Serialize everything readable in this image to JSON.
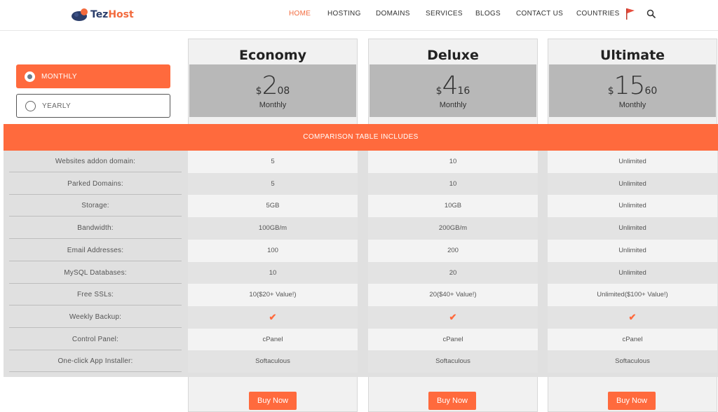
{
  "nav": {
    "logo_a": "Tez",
    "logo_b": "Host",
    "items": [
      "HOME",
      "HOSTING",
      "DOMAINS",
      "SERVICES",
      "BLOGS",
      "CONTACT US",
      "COUNTRIES"
    ]
  },
  "billing": {
    "monthly": "MONTHLY",
    "yearly": "YEARLY"
  },
  "plans": [
    {
      "name": "Economy",
      "currency": "$",
      "whole": "2",
      "cents": "08",
      "period": "Monthly",
      "buy": "Buy Now"
    },
    {
      "name": "Deluxe",
      "currency": "$",
      "whole": "4",
      "cents": "16",
      "period": "Monthly",
      "buy": "Buy Now"
    },
    {
      "name": "Ultimate",
      "currency": "$",
      "whole": "15",
      "cents": "60",
      "period": "Monthly",
      "buy": "Buy Now"
    }
  ],
  "comparison_title": "COMPARISON TABLE INCLUDES",
  "rows": [
    {
      "label": "Websites addon domain:",
      "values": [
        "5",
        "10",
        "Unlimited"
      ]
    },
    {
      "label": "Parked Domains:",
      "values": [
        "5",
        "10",
        "Unlimited"
      ]
    },
    {
      "label": "Storage:",
      "values": [
        "5GB",
        "10GB",
        "Unlimited"
      ]
    },
    {
      "label": "Bandwidth:",
      "values": [
        "100GB/m",
        "200GB/m",
        "Unlimited"
      ]
    },
    {
      "label": "Email Addresses:",
      "values": [
        "100",
        "200",
        "Unlimited"
      ]
    },
    {
      "label": "MySQL Databases:",
      "values": [
        "10",
        "20",
        "Unlimited"
      ]
    },
    {
      "label": "Free SSLs:",
      "values": [
        "10($20+ Value!)",
        "20($40+ Value!)",
        "Unlimited($100+ Value!)"
      ]
    },
    {
      "label": "Weekly Backup:",
      "values": [
        "✔",
        "✔",
        "✔"
      ]
    },
    {
      "label": "Control Panel:",
      "values": [
        "cPanel",
        "cPanel",
        "cPanel"
      ]
    },
    {
      "label": "One-click App Installer:",
      "values": [
        "Softaculous",
        "Softaculous",
        "Softaculous"
      ]
    }
  ],
  "colors": {
    "accent": "#ff6a3d",
    "brand_dark": "#2b3e6b"
  }
}
